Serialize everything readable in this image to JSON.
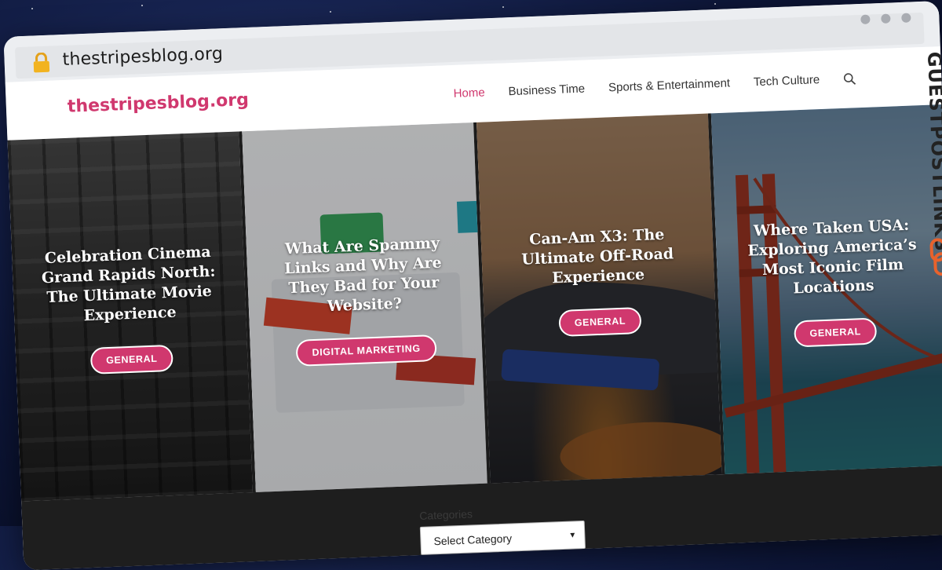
{
  "browser": {
    "url": "thestripesblog.org"
  },
  "site": {
    "logo": "thestripesblog.org",
    "nav": [
      {
        "label": "Home",
        "active": true
      },
      {
        "label": "Business Time",
        "active": false
      },
      {
        "label": "Sports & Entertainment",
        "active": false
      },
      {
        "label": "Tech Culture",
        "active": false
      }
    ]
  },
  "cards": [
    {
      "title": "Celebration Cinema Grand Rapids North: The Ultimate Movie Experience",
      "category": "GENERAL"
    },
    {
      "title": "What Are Spammy Links and Why Are They Bad for Your Website?",
      "category": "DIGITAL MARKETING"
    },
    {
      "title": "Can-Am X3: The Ultimate Off-Road Experience",
      "category": "GENERAL"
    },
    {
      "title": "Where Taken USA: Exploring America’s Most Iconic Film Locations",
      "category": "GENERAL"
    }
  ],
  "footer": {
    "categories_label": "Categories",
    "select_placeholder": "Select Category"
  },
  "overlay_brand": "GUESTPOSTLINKS",
  "colors": {
    "accent": "#d0386e",
    "dark_bg": "#1e1e1e",
    "brand_orange": "#e8622c"
  }
}
